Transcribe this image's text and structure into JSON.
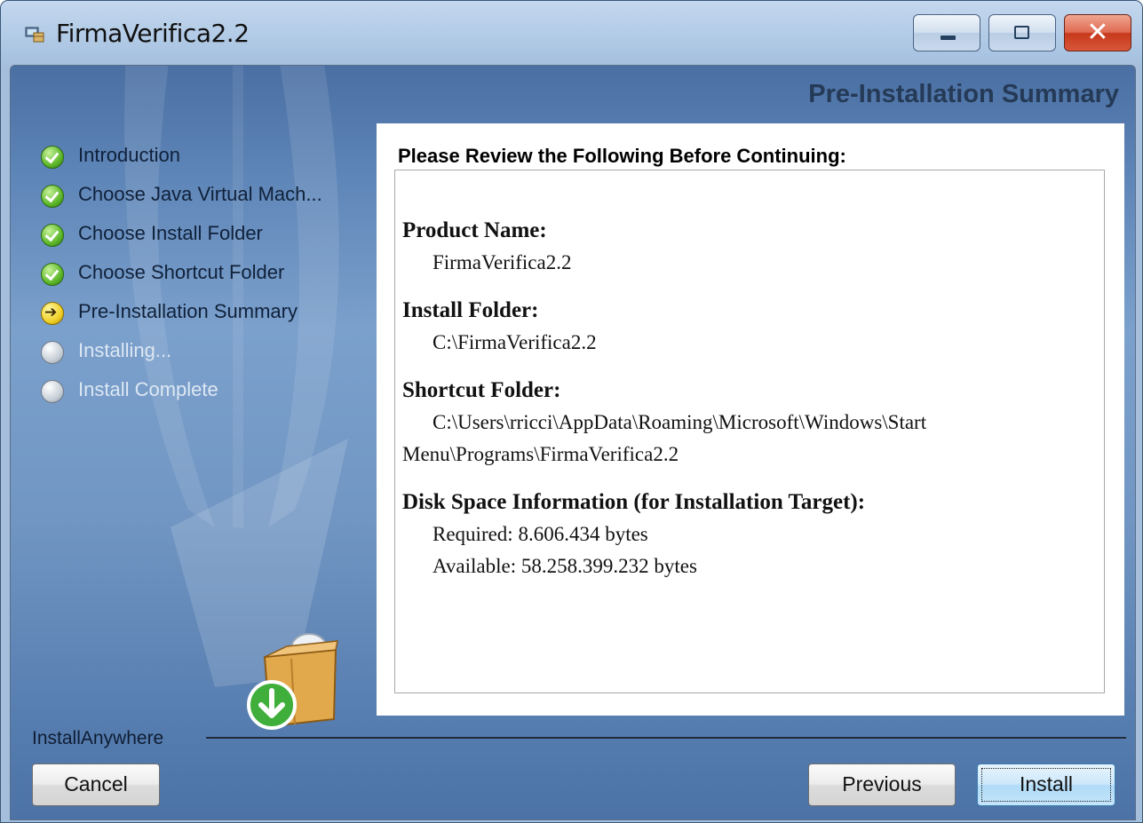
{
  "window": {
    "title": "FirmaVerifica2.2",
    "controls": {
      "minimize": "minimize",
      "maximize": "maximize",
      "close": "✕"
    },
    "title_icon": "installer-app-icon"
  },
  "header": {
    "title": "Pre-Installation Summary"
  },
  "steps": [
    {
      "label": "Introduction",
      "state": "done",
      "icon": "check-icon"
    },
    {
      "label": "Choose Java Virtual Mach...",
      "state": "done",
      "icon": "check-icon"
    },
    {
      "label": "Choose Install Folder",
      "state": "done",
      "icon": "check-icon"
    },
    {
      "label": "Choose Shortcut Folder",
      "state": "done",
      "icon": "check-icon"
    },
    {
      "label": "Pre-Installation Summary",
      "state": "current",
      "icon": "arrow-right-icon"
    },
    {
      "label": "Installing...",
      "state": "pending",
      "icon": "pending-circle-icon"
    },
    {
      "label": "Install Complete",
      "state": "pending",
      "icon": "pending-circle-icon"
    }
  ],
  "panel": {
    "heading": "Please Review the Following Before Continuing:",
    "product_name": {
      "label": "Product Name:",
      "value": "FirmaVerifica2.2"
    },
    "install_folder": {
      "label": "Install Folder:",
      "value": "C:\\FirmaVerifica2.2"
    },
    "shortcut_folder": {
      "label": "Shortcut Folder:",
      "value": "C:\\Users\\rricci\\AppData\\Roaming\\Microsoft\\Windows\\Start Menu\\Programs\\FirmaVerifica2.2"
    },
    "disk_space": {
      "label": "Disk Space Information (for Installation Target):",
      "required": "Required: 8.606.434 bytes",
      "available": "Available: 58.258.399.232 bytes"
    }
  },
  "footer": {
    "brand": "InstallAnywhere",
    "cancel_label": "Cancel",
    "previous_label": "Previous",
    "install_label": "Install"
  }
}
